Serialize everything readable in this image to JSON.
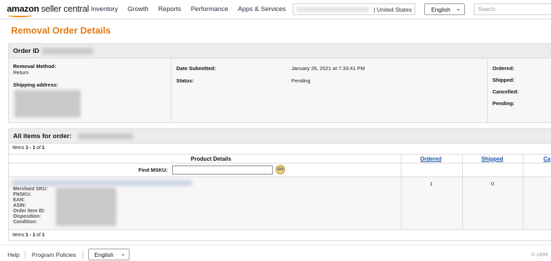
{
  "nav": {
    "logo_brand": "amazon",
    "logo_sub": "seller central",
    "links": [
      "Inventory",
      "Growth",
      "Reports",
      "Performance",
      "Apps & Services"
    ],
    "marketplace": "| United States",
    "language": "English",
    "search_placeholder": "Search"
  },
  "page_title": "Removal Order Details",
  "order": {
    "header_label": "Order ID",
    "removal_method_label": "Removal Method:",
    "removal_method_value": "Return",
    "shipping_address_label": "Shipping address:",
    "date_submitted_label": "Date Submitted:",
    "date_submitted_value": "January 26, 2021 at 7:33:41 PM",
    "status_label": "Status:",
    "status_value": "Pending",
    "qty_labels": [
      "Ordered:",
      "Shipped:",
      "Cancelled:",
      "Pending:"
    ]
  },
  "items": {
    "header_label": "All items for order:",
    "count_prefix": "Items",
    "count_range": "1 - 1",
    "count_of": "of",
    "count_total": "1",
    "columns": {
      "product_details": "Product Details",
      "ordered": "Ordered",
      "shipped": "Shipped",
      "cancelled": "Ca"
    },
    "find_msku_label": "Find MSKU:",
    "go_label": "GO",
    "attributes": [
      "Merchant SKU:",
      "FNSKU:",
      "EAN:",
      "ASIN:",
      "Order Item ID:",
      "Disposition:",
      "Condition:"
    ],
    "row": {
      "ordered": "1",
      "shipped": "0"
    }
  },
  "footer": {
    "help": "Help",
    "program_policies": "Program Policies",
    "language": "English",
    "copyright": "© 1999"
  },
  "colors": {
    "title_orange": "#e47911",
    "link_blue": "#1a54a8",
    "logo_smile": "#f08804"
  }
}
